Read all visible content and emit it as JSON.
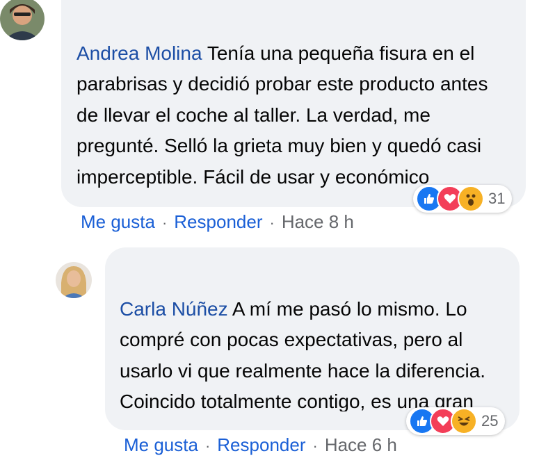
{
  "comments": [
    {
      "author": "Andrea Molina",
      "text": "Tenía una pequeña fisura en el parabrisas y decidió probar este producto antes de llevar el coche al taller. La verdad, me pregunté. Selló la grieta muy bien y quedó casi imperceptible. Fácil de usar y económico",
      "reactions": {
        "icons": [
          "like-icon",
          "love-icon",
          "wow-icon"
        ],
        "count": "31"
      },
      "actions": {
        "like": "Me gusta",
        "reply": "Responder",
        "time": "Hace 8 h"
      }
    },
    {
      "author": "Carla Núñez",
      "text": "A mí me pasó lo mismo. Lo compré con pocas expectativas, pero al usarlo vi que realmente hace la diferencia. Coincido totalmente contigo, es una gran solución si se usa a tiempo",
      "reactions": {
        "icons": [
          "like-icon",
          "love-icon",
          "haha-icon"
        ],
        "count": "25"
      },
      "actions": {
        "like": "Me gusta",
        "reply": "Responder",
        "time": "Hace 6 h"
      }
    }
  ],
  "colors": {
    "author": "#1c4ea5",
    "link": "#1a5fd6",
    "bubble": "#f0f2f5",
    "like": "#1877f2",
    "love": "#f33e58",
    "emoji": "#f7b125"
  }
}
